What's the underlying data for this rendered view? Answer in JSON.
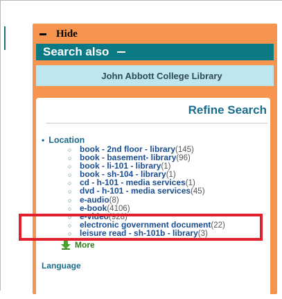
{
  "panel": {
    "hide_label": "Hide",
    "search_also_label": "Search also",
    "library_name": "John Abbott College Library"
  },
  "refine": {
    "title": "Refine Search",
    "facet_label": "Location",
    "items": [
      {
        "label": "book - 2nd floor - library",
        "count": "(145)"
      },
      {
        "label": "book - basement- library",
        "count": "(96)"
      },
      {
        "label": "book - li-101 - library",
        "count": "(1)"
      },
      {
        "label": "book - sh-104 - library",
        "count": "(1)"
      },
      {
        "label": "cd - h-101 - media services",
        "count": "(1)"
      },
      {
        "label": "dvd - h-101 - media services",
        "count": "(45)"
      },
      {
        "label": "e-audio",
        "count": "(8)"
      },
      {
        "label": "e-book",
        "count": "(4106)"
      },
      {
        "label": "e-video",
        "count": "(928)"
      },
      {
        "label": "electronic government document",
        "count": "(22)"
      },
      {
        "label": "leisure read - sh-101b - library",
        "count": "(3)"
      }
    ],
    "more_label": "More",
    "next_facet_label": "Language"
  },
  "colors": {
    "panel": "#f7954f",
    "search_also_bar": "#0b7a85",
    "library_band": "#bde6ee",
    "link": "#1a4d8f",
    "highlight": "#e0202a"
  }
}
